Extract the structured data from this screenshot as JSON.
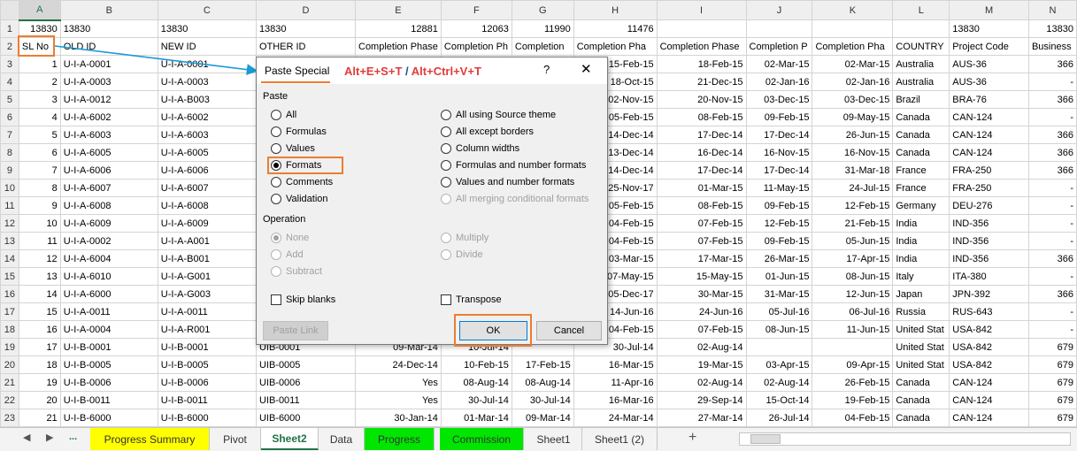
{
  "columns": [
    "A",
    "B",
    "C",
    "D",
    "E",
    "F",
    "G",
    "H",
    "I",
    "J",
    "K",
    "L",
    "M",
    "N"
  ],
  "rows": [
    {
      "n": "1",
      "c": [
        "13830",
        "13830",
        "13830",
        "13830",
        "12881",
        "12063",
        "11990",
        "11476",
        "",
        "",
        "",
        "",
        "13830",
        "13830"
      ]
    },
    {
      "n": "2",
      "c": [
        "SL No",
        "OLD ID",
        "NEW ID",
        "OTHER ID",
        "Completion Phase",
        "Completion Ph",
        "Completion",
        "Completion Pha",
        "Completion Phase",
        "Completion P",
        "Completion Pha",
        "COUNTRY",
        "Project Code",
        "Business"
      ]
    },
    {
      "n": "3",
      "c": [
        "1",
        "U-I-A-0001",
        "U-I-A-0001",
        "",
        "",
        "",
        "",
        "15-Feb-15",
        "18-Feb-15",
        "02-Mar-15",
        "02-Mar-15",
        "Australia",
        "AUS-36",
        "366"
      ]
    },
    {
      "n": "4",
      "c": [
        "2",
        "U-I-A-0003",
        "U-I-A-0003",
        "",
        "",
        "",
        "",
        "18-Oct-15",
        "21-Dec-15",
        "02-Jan-16",
        "02-Jan-16",
        "Australia",
        "AUS-36",
        "-"
      ]
    },
    {
      "n": "5",
      "c": [
        "3",
        "U-I-A-0012",
        "U-I-A-B003",
        "",
        "",
        "",
        "",
        "02-Nov-15",
        "20-Nov-15",
        "03-Dec-15",
        "03-Dec-15",
        "Brazil",
        "BRA-76",
        "366"
      ]
    },
    {
      "n": "6",
      "c": [
        "4",
        "U-I-A-6002",
        "U-I-A-6002",
        "",
        "",
        "",
        "",
        "05-Feb-15",
        "08-Feb-15",
        "09-Feb-15",
        "09-May-15",
        "Canada",
        "CAN-124",
        "-"
      ]
    },
    {
      "n": "7",
      "c": [
        "5",
        "U-I-A-6003",
        "U-I-A-6003",
        "",
        "",
        "",
        "",
        "14-Dec-14",
        "17-Dec-14",
        "17-Dec-14",
        "26-Jun-15",
        "Canada",
        "CAN-124",
        "366"
      ]
    },
    {
      "n": "8",
      "c": [
        "6",
        "U-I-A-6005",
        "U-I-A-6005",
        "",
        "",
        "",
        "",
        "13-Dec-14",
        "16-Dec-14",
        "16-Nov-15",
        "16-Nov-15",
        "Canada",
        "CAN-124",
        "366"
      ]
    },
    {
      "n": "9",
      "c": [
        "7",
        "U-I-A-6006",
        "U-I-A-6006",
        "",
        "",
        "",
        "",
        "14-Dec-14",
        "17-Dec-14",
        "17-Dec-14",
        "31-Mar-18",
        "France",
        "FRA-250",
        "366"
      ]
    },
    {
      "n": "10",
      "c": [
        "8",
        "U-I-A-6007",
        "U-I-A-6007",
        "",
        "",
        "",
        "",
        "25-Nov-17",
        "01-Mar-15",
        "11-May-15",
        "24-Jul-15",
        "France",
        "FRA-250",
        "-"
      ]
    },
    {
      "n": "11",
      "c": [
        "9",
        "U-I-A-6008",
        "U-I-A-6008",
        "",
        "",
        "",
        "",
        "05-Feb-15",
        "08-Feb-15",
        "09-Feb-15",
        "12-Feb-15",
        "Germany",
        "DEU-276",
        "-"
      ]
    },
    {
      "n": "12",
      "c": [
        "10",
        "U-I-A-6009",
        "U-I-A-6009",
        "",
        "",
        "",
        "",
        "04-Feb-15",
        "07-Feb-15",
        "12-Feb-15",
        "21-Feb-15",
        "India",
        "IND-356",
        "-"
      ]
    },
    {
      "n": "13",
      "c": [
        "11",
        "U-I-A-0002",
        "U-I-A-A001",
        "",
        "",
        "",
        "",
        "04-Feb-15",
        "07-Feb-15",
        "09-Feb-15",
        "05-Jun-15",
        "India",
        "IND-356",
        "-"
      ]
    },
    {
      "n": "14",
      "c": [
        "12",
        "U-I-A-6004",
        "U-I-A-B001",
        "",
        "",
        "",
        "",
        "03-Mar-15",
        "17-Mar-15",
        "26-Mar-15",
        "17-Apr-15",
        "India",
        "IND-356",
        "366"
      ]
    },
    {
      "n": "15",
      "c": [
        "13",
        "U-I-A-6010",
        "U-I-A-G001",
        "",
        "",
        "",
        "",
        "07-May-15",
        "15-May-15",
        "01-Jun-15",
        "08-Jun-15",
        "Italy",
        "ITA-380",
        "-"
      ]
    },
    {
      "n": "16",
      "c": [
        "14",
        "U-I-A-6000",
        "U-I-A-G003",
        "",
        "",
        "",
        "",
        "05-Dec-17",
        "30-Mar-15",
        "31-Mar-15",
        "12-Jun-15",
        "Japan",
        "JPN-392",
        "366"
      ]
    },
    {
      "n": "17",
      "c": [
        "15",
        "U-I-A-0011",
        "U-I-A-0011",
        "",
        "",
        "",
        "",
        "14-Jun-16",
        "24-Jun-16",
        "05-Jul-16",
        "06-Jul-16",
        "Russia",
        "RUS-643",
        "-"
      ]
    },
    {
      "n": "18",
      "c": [
        "16",
        "U-I-A-0004",
        "U-I-A-R001",
        "",
        "",
        "",
        "",
        "04-Feb-15",
        "07-Feb-15",
        "08-Jun-15",
        "11-Jun-15",
        "United Stat",
        "USA-842",
        "-"
      ]
    },
    {
      "n": "19",
      "c": [
        "17",
        "U-I-B-0001",
        "U-I-B-0001",
        "UIB-0001",
        "09-Mar-14",
        "10-Jul-14",
        "",
        "30-Jul-14",
        "02-Aug-14",
        "",
        "",
        "United Stat",
        "USA-842",
        "679"
      ]
    },
    {
      "n": "20",
      "c": [
        "18",
        "U-I-B-0005",
        "U-I-B-0005",
        "UIB-0005",
        "24-Dec-14",
        "10-Feb-15",
        "17-Feb-15",
        "16-Mar-15",
        "19-Mar-15",
        "03-Apr-15",
        "09-Apr-15",
        "United Stat",
        "USA-842",
        "679"
      ]
    },
    {
      "n": "21",
      "c": [
        "19",
        "U-I-B-0006",
        "U-I-B-0006",
        "UIB-0006",
        "Yes",
        "08-Aug-14",
        "08-Aug-14",
        "11-Apr-16",
        "02-Aug-14",
        "02-Aug-14",
        "26-Feb-15",
        "Canada",
        "CAN-124",
        "679"
      ]
    },
    {
      "n": "22",
      "c": [
        "20",
        "U-I-B-0011",
        "U-I-B-0011",
        "UIB-0011",
        "Yes",
        "30-Jul-14",
        "30-Jul-14",
        "16-Mar-16",
        "29-Sep-14",
        "15-Oct-14",
        "19-Feb-15",
        "Canada",
        "CAN-124",
        "679"
      ]
    },
    {
      "n": "23",
      "c": [
        "21",
        "U-I-B-6000",
        "U-I-B-6000",
        "UIB-6000",
        "30-Jan-14",
        "01-Mar-14",
        "09-Mar-14",
        "24-Mar-14",
        "27-Mar-14",
        "26-Jul-14",
        "04-Feb-15",
        "Canada",
        "CAN-124",
        "679"
      ]
    }
  ],
  "dialog": {
    "title": "Paste Special",
    "shortcut_a": "Alt+E+S+T",
    "shortcut_sep": "/",
    "shortcut_b": "Alt+Ctrl+V+T",
    "help": "?",
    "close": "✕",
    "paste_group": "Paste",
    "paste_left": [
      "All",
      "Formulas",
      "Values",
      "Formats",
      "Comments",
      "Validation"
    ],
    "paste_right": [
      "All using Source theme",
      "All except borders",
      "Column widths",
      "Formulas and number formats",
      "Values and number formats",
      "All merging conditional formats"
    ],
    "selected_paste": "Formats",
    "operation_group": "Operation",
    "op_left": [
      "None",
      "Add",
      "Subtract"
    ],
    "op_right": [
      "Multiply",
      "Divide"
    ],
    "skip_blanks": "Skip blanks",
    "transpose": "Transpose",
    "paste_link": "Paste Link",
    "ok": "OK",
    "cancel": "Cancel"
  },
  "tabs": {
    "nav_prev": "◀",
    "nav_next": "▶",
    "ellipsis": "...",
    "items": [
      {
        "label": "Progress Summary"
      },
      {
        "label": "Pivot"
      },
      {
        "label": "Sheet2"
      },
      {
        "label": "Data"
      },
      {
        "label": "Progress"
      },
      {
        "label": "Commission"
      },
      {
        "label": "Sheet1"
      },
      {
        "label": "Sheet1 (2)"
      }
    ],
    "add": "+",
    "colors": {
      "yellow": "#ffff00",
      "green": "#00e600",
      "accent": "#217346",
      "highlight": "#ed7d31",
      "arrow": "#1a9ad6"
    }
  }
}
